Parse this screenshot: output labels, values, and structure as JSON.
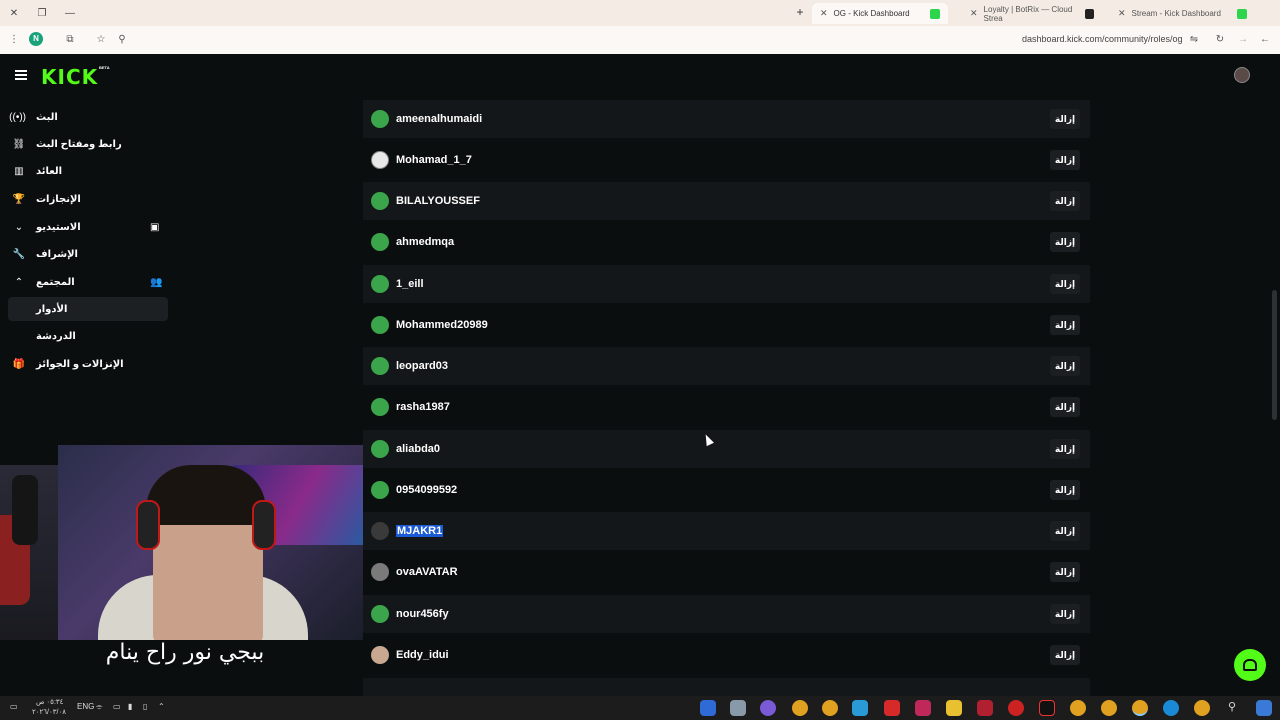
{
  "browser": {
    "tabs": [
      {
        "title": "OG - Kick Dashboard",
        "active": true
      },
      {
        "title": "Loyalty | BotRix — Cloud Strea",
        "active": false
      },
      {
        "title": "Stream - Kick Dashboard",
        "active": false
      }
    ],
    "profile_initial": "N",
    "url": "dashboard.kick.com/community/roles/og"
  },
  "header": {
    "logo": "KICK",
    "beta": "BETA"
  },
  "sidebar": {
    "items": [
      {
        "label": "البث",
        "icon": "broadcast-icon"
      },
      {
        "label": "رابط ومفتاح البث",
        "icon": "link-icon"
      },
      {
        "label": "العائد",
        "icon": "chart-icon"
      },
      {
        "label": "الإنجازات",
        "icon": "trophy-icon"
      },
      {
        "label": "الاستيديو",
        "icon": "chevron-down-icon"
      },
      {
        "label": "الإشراف",
        "icon": "wrench-icon"
      },
      {
        "label": "المجتمع",
        "icon": "chevron-up-icon"
      },
      {
        "label": "الأدوار",
        "icon": ""
      },
      {
        "label": "الدردشة",
        "icon": ""
      },
      {
        "label": "الإنزالات و الجوائز",
        "icon": "gift-icon"
      }
    ]
  },
  "members": {
    "remove_label": "إزالة",
    "rows": [
      {
        "username": "ameenalhumaidi",
        "avatar": "green"
      },
      {
        "username": "Mohamad_1_7",
        "avatar": "light"
      },
      {
        "username": "BILALYOUSSEF",
        "avatar": "green"
      },
      {
        "username": "ahmedmqa",
        "avatar": "green"
      },
      {
        "username": "1_eill",
        "avatar": "green"
      },
      {
        "username": "Mohammed20989",
        "avatar": "green"
      },
      {
        "username": "leopard03",
        "avatar": "green"
      },
      {
        "username": "rasha1987",
        "avatar": "green"
      },
      {
        "username": "aliabda0",
        "avatar": "green"
      },
      {
        "username": "0954099592",
        "avatar": "green"
      },
      {
        "username": "MJAKR1",
        "avatar": "dark"
      },
      {
        "username": "ovaAVATAR",
        "avatar": "grey"
      },
      {
        "username": "nour456fy",
        "avatar": "green"
      },
      {
        "username": "Eddy_idui",
        "avatar": "tan"
      }
    ]
  },
  "overlay": {
    "subtitle": "ببجي نور راح ينام"
  },
  "taskbar": {
    "time": "٠٥:٣٤ ص",
    "date": "٢٠٢٦/٠٣/٠٨",
    "lang": "ENG"
  }
}
